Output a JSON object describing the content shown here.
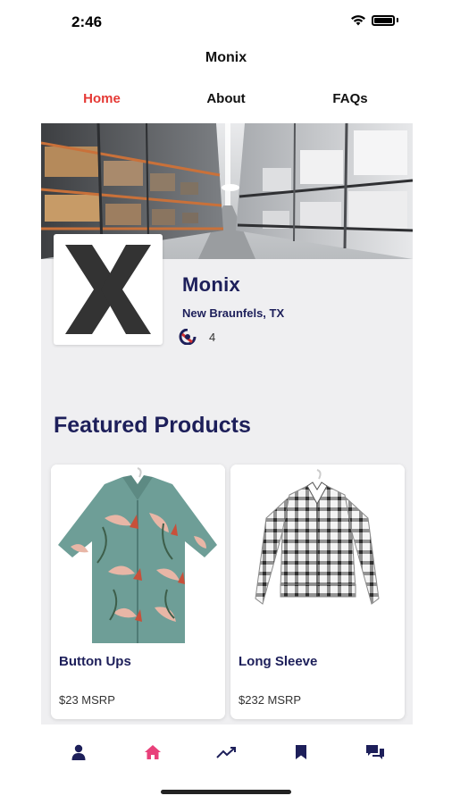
{
  "status_bar": {
    "time": "2:46",
    "icons": [
      "wifi-icon",
      "battery-icon"
    ]
  },
  "app": {
    "title": "Monix"
  },
  "tabs": [
    {
      "label": "Home",
      "active": true
    },
    {
      "label": "About",
      "active": false
    },
    {
      "label": "FAQs",
      "active": false
    }
  ],
  "store": {
    "name": "Monix",
    "location": "New Braunfels, TX",
    "rating_count": "4",
    "rating_icon": "badge-icon"
  },
  "featured": {
    "title": "Featured Products",
    "products": [
      {
        "name": "Button Ups",
        "price": "$23 MSRP"
      },
      {
        "name": "Long Sleeve",
        "price": "$232 MSRP"
      }
    ]
  },
  "bottom_nav": [
    {
      "icon": "profile-icon",
      "active": false
    },
    {
      "icon": "home-icon",
      "active": true
    },
    {
      "icon": "trending-icon",
      "active": false
    },
    {
      "icon": "bookmark-icon",
      "active": false
    },
    {
      "icon": "chat-icon",
      "active": false
    }
  ],
  "colors": {
    "accent": "#e53935",
    "brand_navy": "#1d1f5a",
    "active_nav": "#e8407a",
    "background_panel": "#efeff1"
  }
}
